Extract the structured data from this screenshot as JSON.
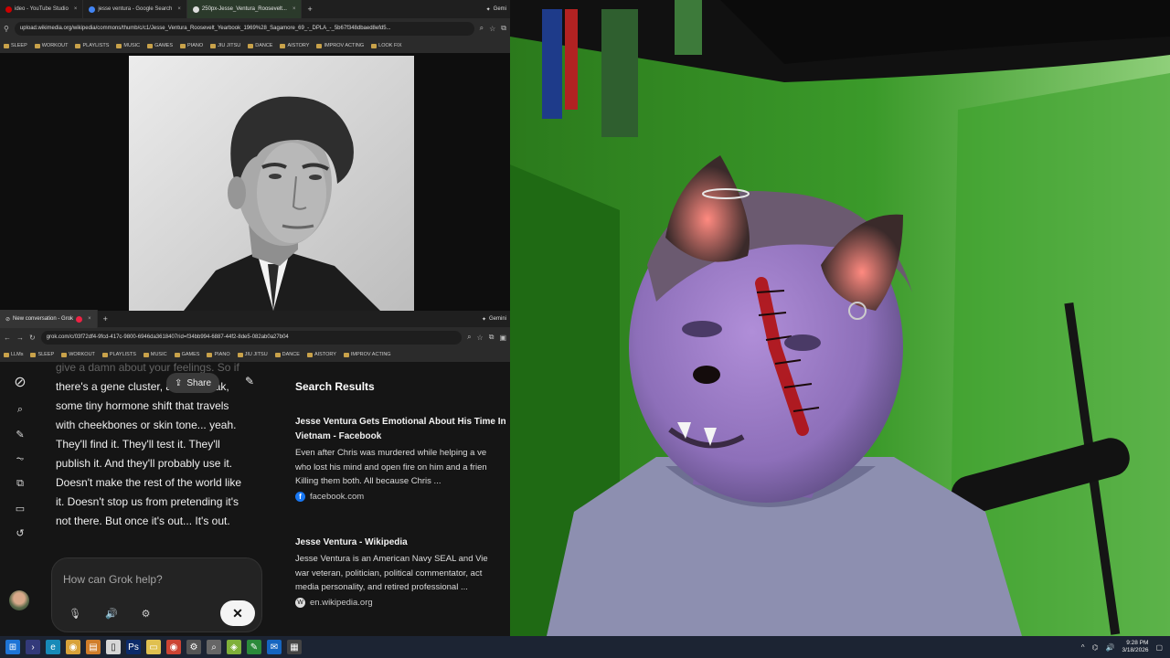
{
  "top_browser": {
    "tabs": [
      {
        "title": "ideo - YouTube Studio",
        "icon": "youtube-icon",
        "active": false
      },
      {
        "title": "jesse ventura - Google Search",
        "icon": "google-icon",
        "active": false
      },
      {
        "title": "250px-Jesse_Ventura_Roosevelt...",
        "icon": "wiki-icon",
        "active": true
      }
    ],
    "gemini_label": "Gemi",
    "url": "upload.wikimedia.org/wikipedia/commons/thumb/c/c1/Jesse_Ventura_Roosevelt_Yearbook_1969%28_Sagamore_69_-_DPLA_-_5b67f348dbaed8efd5...",
    "bookmarks": [
      "SLEEP",
      "WORKOUT",
      "PLAYLISTS",
      "MUSIC",
      "GAMES",
      "PIANO",
      "JIU JITSU",
      "DANCE",
      "AISTORY",
      "IMPROV ACTING",
      "LOOK FIX"
    ]
  },
  "bottom_browser": {
    "tabs": [
      {
        "title": "New conversation - Grok",
        "icon": "grok-icon",
        "active": true
      }
    ],
    "gemini_label": "Gemini",
    "url": "grok.com/c/03f72df4-9fcd-417c-9800-6946da3618407rid=f34bb994-6887-44f2-8de5-082ab0a27b04",
    "bookmarks": [
      "LLMs",
      "SLEEP",
      "WORKOUT",
      "PLAYLISTS",
      "MUSIC",
      "GAMES",
      "PIANO",
      "JIU JITSU",
      "DANCE",
      "AISTORY",
      "IMPROV ACTING"
    ]
  },
  "grok": {
    "chat_lines": [
      "give a damn about your feelings. So if",
      "there's a gene cluster, a little tweak,",
      "some tiny hormone shift that travels",
      "with cheekbones or skin tone... yeah.",
      "They'll find it. They'll test it. They'll",
      "publish it. And they'll probably use it.",
      "Doesn't make the rest of the world like",
      "it. Doesn't stop us from pretending it's",
      "not there. But once it's out... It's out."
    ],
    "share_label": "Share",
    "input_placeholder": "How can Grok help?",
    "search_results_title": "Search Results",
    "results": [
      {
        "title": "Jesse Ventura Gets Emotional About His Time In\nVietnam - Facebook",
        "snippet": "Even after Chris was murdered while helping a ve\nwho lost his mind and open fire on him and a frien\nKilling them both. All because Chris ...",
        "source": "facebook.com",
        "source_icon": "facebook-icon"
      },
      {
        "title": "Jesse Ventura - Wikipedia",
        "snippet": "Jesse Ventura is an American Navy SEAL and Vie\nwar veteran, politician, political commentator, act\nmedia personality, and retired professional ...",
        "source": "en.wikipedia.org",
        "source_icon": "wikipedia-icon"
      }
    ]
  },
  "taskbar": {
    "time": "9:28 PM",
    "date": "3/18/2026",
    "apps": [
      "windows-start-icon",
      "terminal-icon",
      "edge-icon",
      "chrome-icon",
      "file-icon",
      "photoshop-icon",
      "explorer-icon",
      "chrome-alt-icon",
      "settings-icon",
      "search-icon",
      "app-icon",
      "notes-icon",
      "outlook-icon",
      "calculator-icon"
    ]
  },
  "colors": {
    "wall_green": "#2e8a1f",
    "dark_bg": "#141414",
    "taskbar": "#1c2433"
  }
}
